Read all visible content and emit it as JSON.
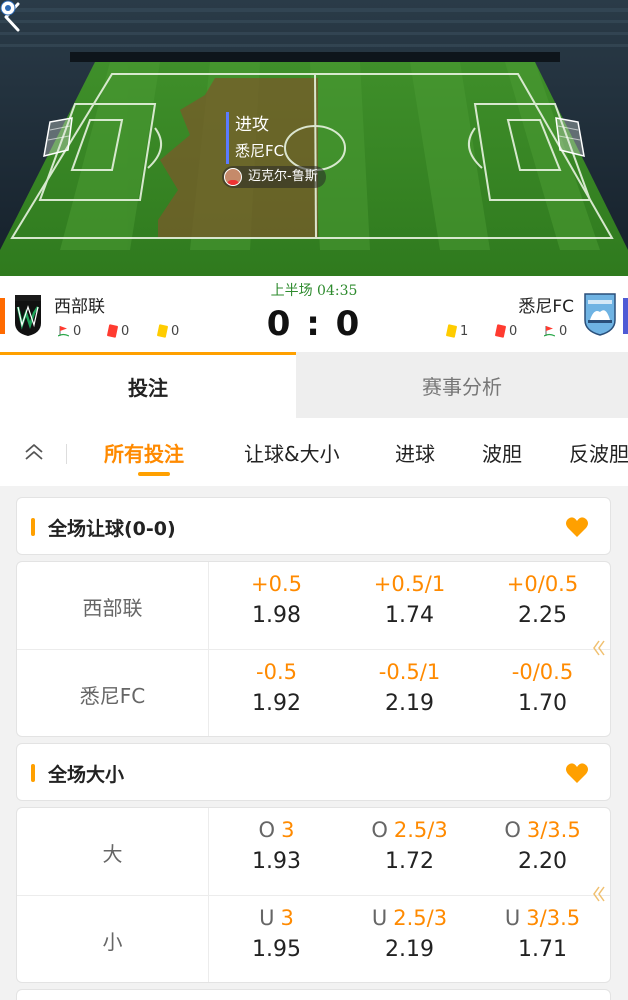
{
  "event": {
    "title": "进攻",
    "team": "悉尼FC",
    "player": "迈克尔-鲁斯"
  },
  "match": {
    "period_time": "上半场 04:35",
    "score": "0 : 0",
    "home": {
      "name": "西部联",
      "corners": "0",
      "red_cards": "0",
      "yellow_cards": "0"
    },
    "away": {
      "name": "悉尼FC",
      "corners": "0",
      "red_cards": "0",
      "yellow_cards": "1"
    }
  },
  "main_tabs": [
    {
      "label": "投注"
    },
    {
      "label": "赛事分析"
    }
  ],
  "sub_tabs": [
    {
      "label": "所有投注"
    },
    {
      "label": "让球&大小"
    },
    {
      "label": "进球"
    },
    {
      "label": "波胆"
    },
    {
      "label": "反波胆"
    }
  ],
  "markets": [
    {
      "title": "全场让球(0-0)",
      "rows": [
        {
          "label": "西部联",
          "odds": [
            {
              "line": "+0.5",
              "price": "1.98"
            },
            {
              "line": "+0.5/1",
              "price": "1.74"
            },
            {
              "line": "+0/0.5",
              "price": "2.25"
            }
          ]
        },
        {
          "label": "悉尼FC",
          "odds": [
            {
              "line": "-0.5",
              "price": "1.92"
            },
            {
              "line": "-0.5/1",
              "price": "2.19"
            },
            {
              "line": "-0/0.5",
              "price": "1.70"
            }
          ]
        }
      ]
    },
    {
      "title": "全场大小",
      "rows": [
        {
          "label": "大",
          "odds": [
            {
              "prefix": "O",
              "line": "3",
              "price": "1.93"
            },
            {
              "prefix": "O",
              "line": "2.5/3",
              "price": "1.72"
            },
            {
              "prefix": "O",
              "line": "3/3.5",
              "price": "2.20"
            }
          ]
        },
        {
          "label": "小",
          "odds": [
            {
              "prefix": "U",
              "line": "3",
              "price": "1.95"
            },
            {
              "prefix": "U",
              "line": "2.5/3",
              "price": "2.19"
            },
            {
              "prefix": "U",
              "line": "3/3.5",
              "price": "1.71"
            }
          ]
        }
      ]
    }
  ],
  "colors": {
    "accent": "#ffa000",
    "odds_line": "#ff8a00",
    "home_accent": "#ff6a00",
    "away_accent": "#4f5bd5",
    "time": "#2e8b2e"
  },
  "icons": [
    "back-arrow-icon",
    "football-icon",
    "corner-flag-icon",
    "red-card-icon",
    "yellow-card-icon",
    "collapse-chevron-icon",
    "heart-icon",
    "double-chevron-left-icon"
  ]
}
